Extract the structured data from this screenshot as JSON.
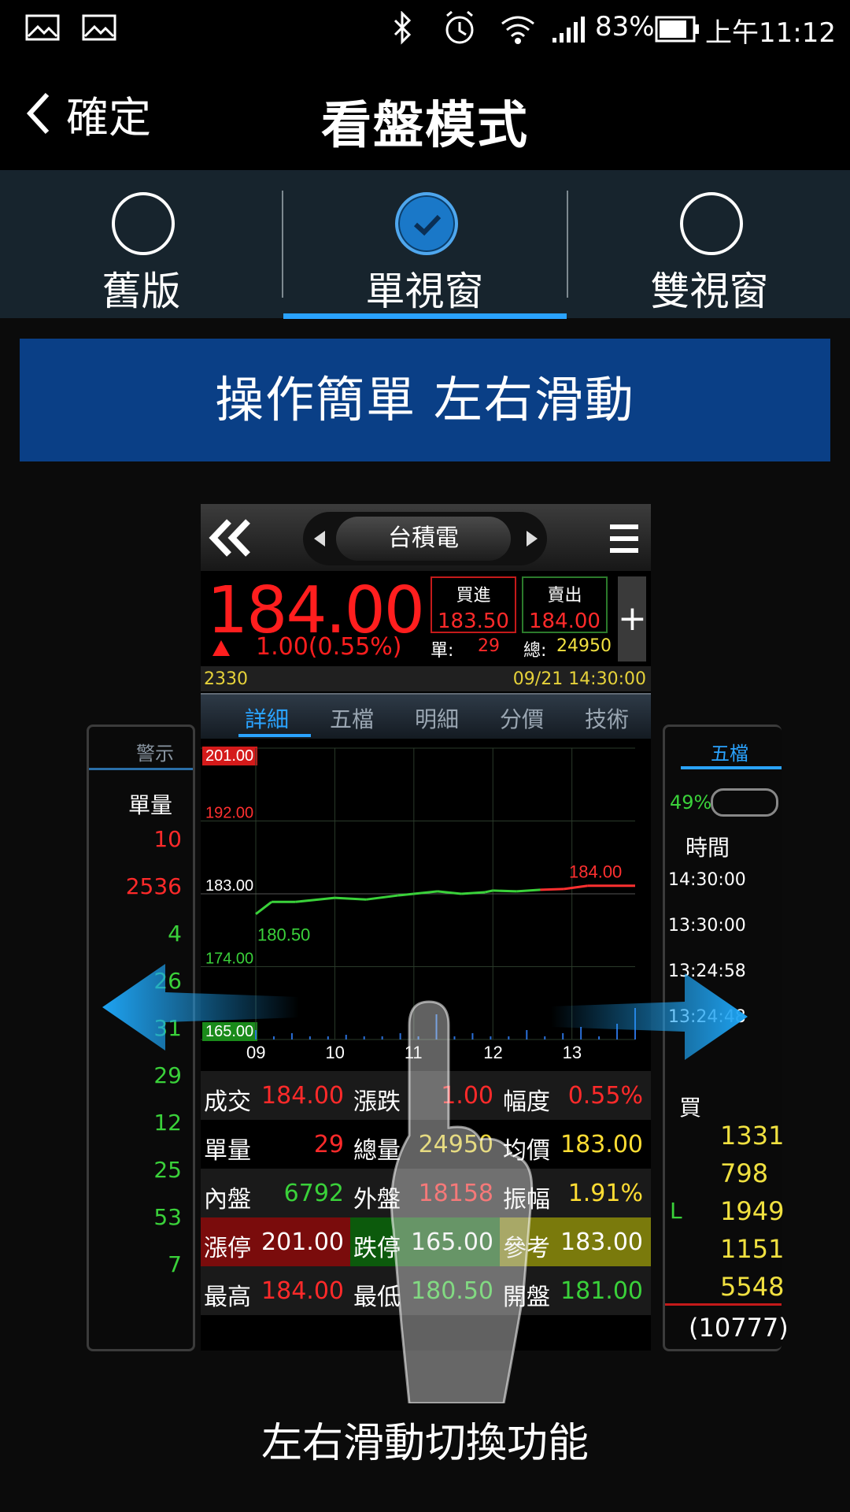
{
  "status_bar": {
    "battery": "83%",
    "time": "上午11:12"
  },
  "header": {
    "back_label": "確定",
    "title": "看盤模式"
  },
  "modes": [
    {
      "label": "舊版",
      "selected": false
    },
    {
      "label": "單視窗",
      "selected": true
    },
    {
      "label": "雙視窗",
      "selected": false
    }
  ],
  "banner": "操作簡單 左右滑動",
  "demo": {
    "stock_name": "台積電",
    "price": "184.00",
    "change": "1.00(0.55%)",
    "bid_label": "買進",
    "bid": "183.50",
    "ask_label": "賣出",
    "ask": "184.00",
    "unit_label": "單:",
    "unit_value": "29",
    "total_label": "總:",
    "total_value": "24950",
    "code": "2330",
    "datetime": "09/21 14:30:00",
    "tabs": [
      "詳細",
      "五檔",
      "明細",
      "分價",
      "技術"
    ],
    "stats": [
      [
        [
          "成交",
          "184.00"
        ],
        [
          "漲跌",
          "1.00"
        ],
        [
          "幅度",
          "0.55%"
        ]
      ],
      [
        [
          "單量",
          "29"
        ],
        [
          "總量",
          "24950"
        ],
        [
          "均價",
          "183.00"
        ]
      ],
      [
        [
          "內盤",
          "6792"
        ],
        [
          "外盤",
          "18158"
        ],
        [
          "振幅",
          "1.91%"
        ]
      ],
      [
        [
          "漲停",
          "201.00"
        ],
        [
          "跌停",
          "165.00"
        ],
        [
          "參考",
          "183.00"
        ]
      ],
      [
        [
          "最高",
          "184.00"
        ],
        [
          "最低",
          "180.50"
        ],
        [
          "開盤",
          "181.00"
        ]
      ]
    ],
    "left_panel": {
      "header": "警示",
      "col": "單量",
      "values": [
        "10",
        "2536",
        "4",
        "26",
        "31",
        "29",
        "12",
        "25",
        "53",
        "7"
      ]
    },
    "right_panel": {
      "header": "五檔",
      "percent": "49%",
      "col": "時間",
      "times": [
        "14:30:00",
        "13:30:00",
        "13:24:58",
        "13:24:48"
      ],
      "buy_label": "買",
      "l_label": "L",
      "values": [
        "1331",
        "798",
        "1949",
        "1151",
        "5548"
      ],
      "footer": "(10777)"
    }
  },
  "chart_data": {
    "type": "line",
    "x_ticks": [
      "09",
      "10",
      "11",
      "12",
      "13"
    ],
    "y_ticks": [
      "201.00",
      "192.00",
      "183.00",
      "174.00",
      "165.00"
    ],
    "ylim": [
      165,
      201
    ],
    "annotations": [
      "180.50",
      "184.00"
    ],
    "series": [
      {
        "x": [
          0,
          0.2,
          0.5,
          1.0,
          1.4,
          1.8,
          2.0,
          2.3,
          2.6,
          2.9,
          3.0,
          3.3,
          3.6,
          3.9,
          4.2,
          4.8
        ],
        "y": [
          180.5,
          182.0,
          182.0,
          182.5,
          182.3,
          182.8,
          183.0,
          183.3,
          183.0,
          183.2,
          183.4,
          183.3,
          183.5,
          183.6,
          184.0,
          184.0
        ]
      }
    ],
    "volume": [
      0.3,
      0.1,
      0.2,
      0.1,
      0.1,
      0.15,
      0.1,
      0.1,
      0.2,
      0.1,
      0.8,
      0.1,
      0.2,
      0.1,
      0.1,
      0.3,
      0.1,
      0.2,
      0.4,
      0.1,
      0.5,
      1.0
    ]
  },
  "caption": "左右滑動切換功能"
}
